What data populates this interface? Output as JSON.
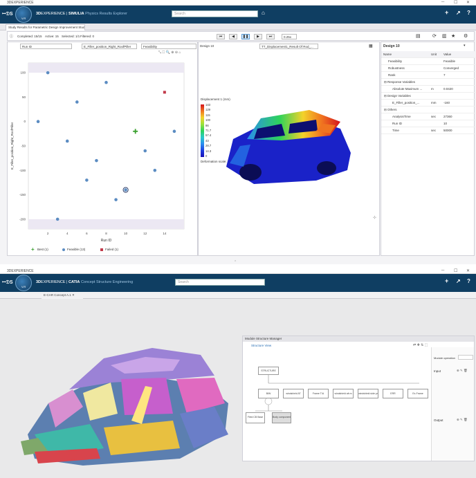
{
  "top": {
    "window_title": "3DEXPERIENCE",
    "brand": "3D",
    "brand2": "EXPERIENCE",
    "sep": " | ",
    "product": "SIMULIA",
    "app_name": "Physics Results Explorer",
    "compass_label": "V.R",
    "search_placeholder": "Search",
    "tab_label": "Study Results for Parametric Design Improvement Study 1",
    "status": {
      "completed": "Completed: 15/15",
      "active": "Active: 15",
      "selected": "Selected: 1/1",
      "filtered": "Filtered: 0"
    },
    "speed": "0.25x",
    "selects": {
      "x": "Run ID",
      "y": "E_Filler_position_Right_RoofPiller",
      "color": "Feasibility",
      "design": "Design 10",
      "result": "TT_Displacement1_Result Of Rod_..."
    },
    "legend": [
      {
        "label": "Best (1)",
        "color": "#3aa02e"
      },
      {
        "label": "Feasible (13)",
        "color": "#5b8cc2"
      },
      {
        "label": "Failed (1)",
        "color": "#c23a4a"
      }
    ],
    "ylabel": "E_Filler_position_Right_RoofPiller",
    "xlabel": "Run ID",
    "contour": {
      "title": "Displacement 1 (mm)",
      "ticks": [
        "143",
        "129",
        "115",
        "100",
        "86",
        "71.7",
        "57.4",
        "43",
        "28.7",
        "14.3",
        "0"
      ],
      "footer": "Deformation scale: 1"
    },
    "props": {
      "header": "Design 10",
      "col_name": "Name",
      "col_unit": "Unit",
      "col_value": "Value",
      "rows": [
        {
          "name": "Feasibility",
          "unit": "",
          "value": "Feasible",
          "indent": 1
        },
        {
          "name": "Robustness",
          "unit": "",
          "value": "Converged",
          "indent": 1
        },
        {
          "name": "Rank",
          "unit": "",
          "value": "7",
          "indent": 1
        },
        {
          "name": "Response Variables",
          "unit": "",
          "value": "",
          "indent": 0
        },
        {
          "name": "Absolute Maximum ...",
          "unit": "m",
          "value": "0.0420",
          "indent": 2
        },
        {
          "name": "Design Variables",
          "unit": "",
          "value": "",
          "indent": 0
        },
        {
          "name": "E_Filler_position_...",
          "unit": "mm",
          "value": "-160",
          "indent": 2
        },
        {
          "name": "Others",
          "unit": "",
          "value": "",
          "indent": 0
        },
        {
          "name": "AnalysisTime",
          "unit": "sec",
          "value": "27360",
          "indent": 2
        },
        {
          "name": "Run ID",
          "unit": "",
          "value": "10",
          "indent": 2
        },
        {
          "name": "Time",
          "unit": "sec",
          "value": "50000",
          "indent": 2
        }
      ]
    }
  },
  "chart_data": {
    "type": "scatter",
    "title": "",
    "xlabel": "Run ID",
    "ylabel": "E_Filler_position_Right_RoofPiller",
    "xlim": [
      0,
      16
    ],
    "ylim": [
      -220,
      120
    ],
    "xticks": [
      "2",
      "4",
      "6",
      "8",
      "10",
      "12",
      "14"
    ],
    "yticks": [
      "100",
      "50",
      "0",
      "-50",
      "-100",
      "-150",
      "-200"
    ],
    "series": [
      {
        "name": "Best (1)",
        "color": "#3aa02e",
        "marker": "plus",
        "points": [
          [
            11,
            -20
          ]
        ]
      },
      {
        "name": "Feasible (13)",
        "color": "#5b8cc2",
        "marker": "circle",
        "points": [
          [
            1,
            0
          ],
          [
            2,
            100
          ],
          [
            3,
            -200
          ],
          [
            4,
            -40
          ],
          [
            5,
            40
          ],
          [
            6,
            -120
          ],
          [
            7,
            -80
          ],
          [
            8,
            80
          ],
          [
            9,
            -160
          ],
          [
            10,
            -140
          ],
          [
            12,
            -60
          ],
          [
            13,
            -100
          ],
          [
            15,
            -20
          ]
        ]
      },
      {
        "name": "Failed (1)",
        "color": "#c23a4a",
        "marker": "square",
        "points": [
          [
            14,
            60
          ]
        ]
      }
    ]
  },
  "bottom": {
    "window_title": "3DEXPERIENCE",
    "brand": "3D",
    "brand2": "EXPERIENCE",
    "sep": " | ",
    "product": "CATIA",
    "app_name": "Concept Structure Engineering",
    "compass_label": "V.R",
    "search_placeholder": "Search",
    "tab_label": "E-CAR Concept A.1",
    "msm": {
      "title": "Module Structure Manager",
      "tab": "Structure View",
      "root": "STRUCTURE",
      "children": [
        "BIW",
        "windshield AT",
        "Frame T/A",
        "windshield afr.m",
        "windshield side pr",
        "ERR",
        "Ex-Frame"
      ],
      "sub1": "Field CB Base",
      "sub2": "Body component",
      "side_label": "Module operation",
      "input_label": "Input",
      "output_label": "Output"
    }
  }
}
